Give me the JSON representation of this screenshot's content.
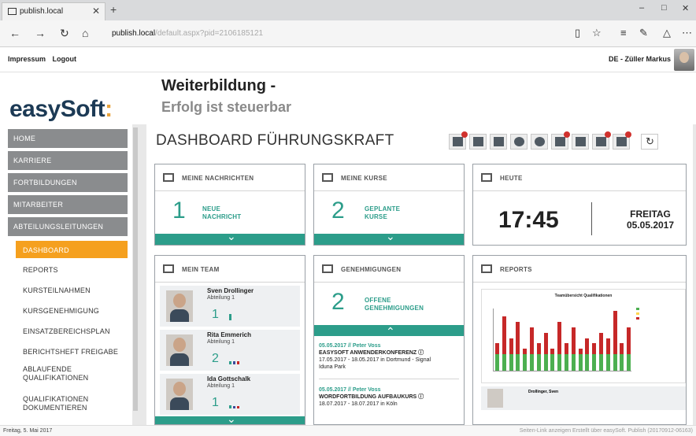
{
  "browser": {
    "tab_title": "publish.local",
    "url_host": "publish.local",
    "url_path": "/default.aspx?pid=2106185121"
  },
  "appbar": {
    "link1": "Impressum",
    "link2": "Logout",
    "lang": "DE",
    "user": "- Züller Markus"
  },
  "header": {
    "logo": "easySoft",
    "slogan_line1": "Weiterbildung -",
    "slogan_line2": "Erfolg ist steuerbar"
  },
  "sidebar": {
    "main_items": [
      "HOME",
      "KARRIERE",
      "FORTBILDUNGEN",
      "MITARBEITER",
      "ABTEILUNGSLEITUNGEN"
    ],
    "sub_items": [
      "DASHBOARD",
      "REPORTS",
      "KURSTEILNAHMEN",
      "KURSGENEHMIGUNG",
      "EINSATZBEREICHSPLAN",
      "BERICHTSHEFT FREIGABE",
      "ABLAUFENDE QUALIFIKATIONEN",
      "QUALIFIKATIONEN DOKUMENTIEREN"
    ]
  },
  "main": {
    "title": "DASHBOARD FÜHRUNGSKRAFT",
    "toolbar_icons": [
      "mail-icon",
      "bar-chart-icon",
      "calendar-icon",
      "pie-chart-icon",
      "pie-chart-icon",
      "courses-icon",
      "line-chart-icon",
      "approval-icon",
      "star-icon",
      "refresh-icon"
    ]
  },
  "panels": {
    "messages": {
      "title": "MEINE NACHRICHTEN",
      "count": "1",
      "label1": "NEUE",
      "label2": "NACHRICHT"
    },
    "courses": {
      "title": "MEINE KURSE",
      "count": "2",
      "label1": "GEPLANTE",
      "label2": "KURSE"
    },
    "today": {
      "title": "HEUTE",
      "time": "17:45",
      "day": "FREITAG",
      "date": "05.05.2017"
    },
    "team": {
      "title": "MEIN TEAM",
      "members": [
        {
          "name": "Sven Drollinger",
          "dept": "Abteilung 1",
          "count": "1"
        },
        {
          "name": "Rita Emmerich",
          "dept": "Abteilung 1",
          "count": "2"
        },
        {
          "name": "Ida Gottschalk",
          "dept": "Abteilung 1",
          "count": "1"
        }
      ]
    },
    "approvals": {
      "title": "GENEHMIGUNGEN",
      "count": "2",
      "label1": "OFFENE",
      "label2": "GENEHMIGUNGEN",
      "items": [
        {
          "date": "05.05.2017 // Peter Voss",
          "course": "EASYSOFT ANWENDERKONFERENZ ⓘ",
          "info1": "17.05.2017 - 18.05.2017 in Dortmund - Signal",
          "info2": "Iduna Park"
        },
        {
          "date": "05.05.2017 // Peter Voss",
          "course": "WORDFORTBILDUNG AUFBAUKURS ⓘ",
          "info1": "18.07.2017 - 18.07.2017 in Köln",
          "info2": ""
        }
      ]
    },
    "reports": {
      "title": "REPORTS",
      "chart_title": "Teamübersicht Qualifikationen",
      "footer_name": "Drollinger, Sven"
    }
  },
  "chart_data": {
    "type": "bar",
    "title": "Teamübersicht Qualifikationen",
    "series": [
      {
        "name": "",
        "color": "#4caf50",
        "values": [
          3,
          3,
          3,
          3,
          3,
          3,
          3,
          3,
          3,
          3,
          3,
          3,
          3,
          3,
          3,
          3,
          3,
          3,
          3,
          3
        ]
      },
      {
        "name": "",
        "color": "#c62828",
        "values": [
          2,
          7,
          3,
          6,
          1,
          5,
          2,
          4,
          1,
          6,
          2,
          5,
          1,
          3,
          2,
          4,
          3,
          8,
          2,
          5
        ]
      },
      {
        "name": "",
        "color": "#ffd54f",
        "values": [
          0,
          0,
          0,
          0,
          0,
          0,
          0,
          0,
          0,
          0,
          0,
          0,
          0,
          0,
          0,
          0,
          0,
          0,
          0,
          0
        ]
      }
    ],
    "legend": [
      "",
      "",
      ""
    ],
    "legend_position": "top-right"
  },
  "status": {
    "left": "Freitag, 5. Mai 2017",
    "right": "Seiten-Link anzeigen Erstellt über easySoft. Publish (20170912-06163)"
  }
}
